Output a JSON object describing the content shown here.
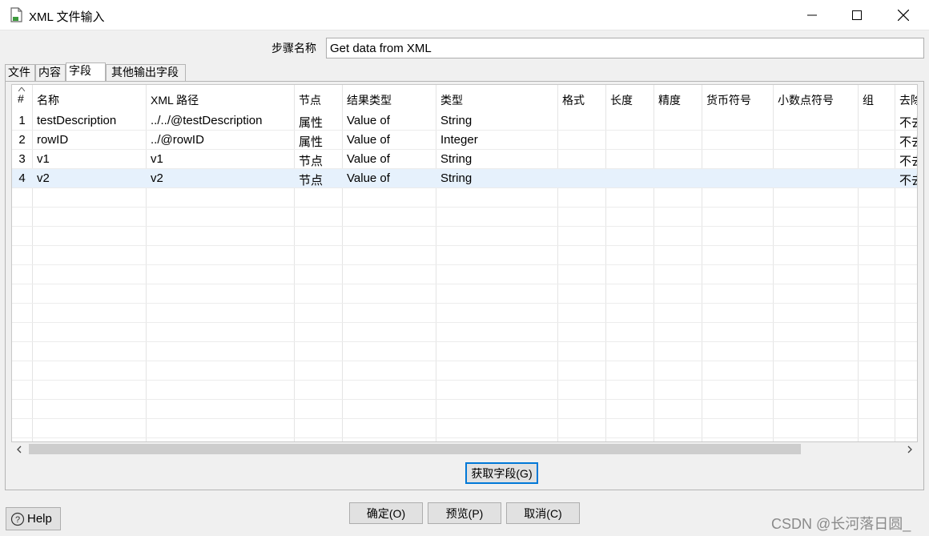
{
  "window": {
    "title": "XML 文件输入",
    "icons": {
      "app": "document-icon",
      "minimize": "minimize-icon",
      "maximize": "maximize-icon",
      "close": "close-icon"
    }
  },
  "step": {
    "label": "步骤名称",
    "value": "Get data from XML"
  },
  "tabs": [
    {
      "label": "文件",
      "active": false
    },
    {
      "label": "内容",
      "active": false
    },
    {
      "label": "字段",
      "active": true
    },
    {
      "label": "其他输出字段",
      "active": false
    }
  ],
  "table": {
    "headers": {
      "num": "#",
      "name": "名称",
      "xpath": "XML 路径",
      "node": "节点",
      "result_type": "结果类型",
      "type": "类型",
      "format": "格式",
      "length": "长度",
      "precision": "精度",
      "currency": "货币符号",
      "decimal": "小数点符号",
      "group": "组",
      "trim": "去除"
    },
    "rows": [
      {
        "num": "1",
        "name": "testDescription",
        "xpath": "../../@testDescription",
        "node": "属性",
        "result_type": "Value of",
        "type": "String",
        "trim": "不去"
      },
      {
        "num": "2",
        "name": "rowID",
        "xpath": "../@rowID",
        "node": "属性",
        "result_type": "Value of",
        "type": "Integer",
        "trim": "不去"
      },
      {
        "num": "3",
        "name": "v1",
        "xpath": "v1",
        "node": "节点",
        "result_type": "Value of",
        "type": "String",
        "trim": "不去"
      },
      {
        "num": "4",
        "name": "v2",
        "xpath": "v2",
        "node": "节点",
        "result_type": "Value of",
        "type": "String",
        "trim": "不去",
        "selected": true
      }
    ]
  },
  "buttons": {
    "get_fields": "获取字段(G)",
    "ok": "确定(O)",
    "preview": "预览(P)",
    "cancel": "取消(C)",
    "help": "Help"
  },
  "watermark": "CSDN @长河落日圆_",
  "colors": {
    "selected_row": "#e6f1fc",
    "focus_border": "#0078d7"
  }
}
